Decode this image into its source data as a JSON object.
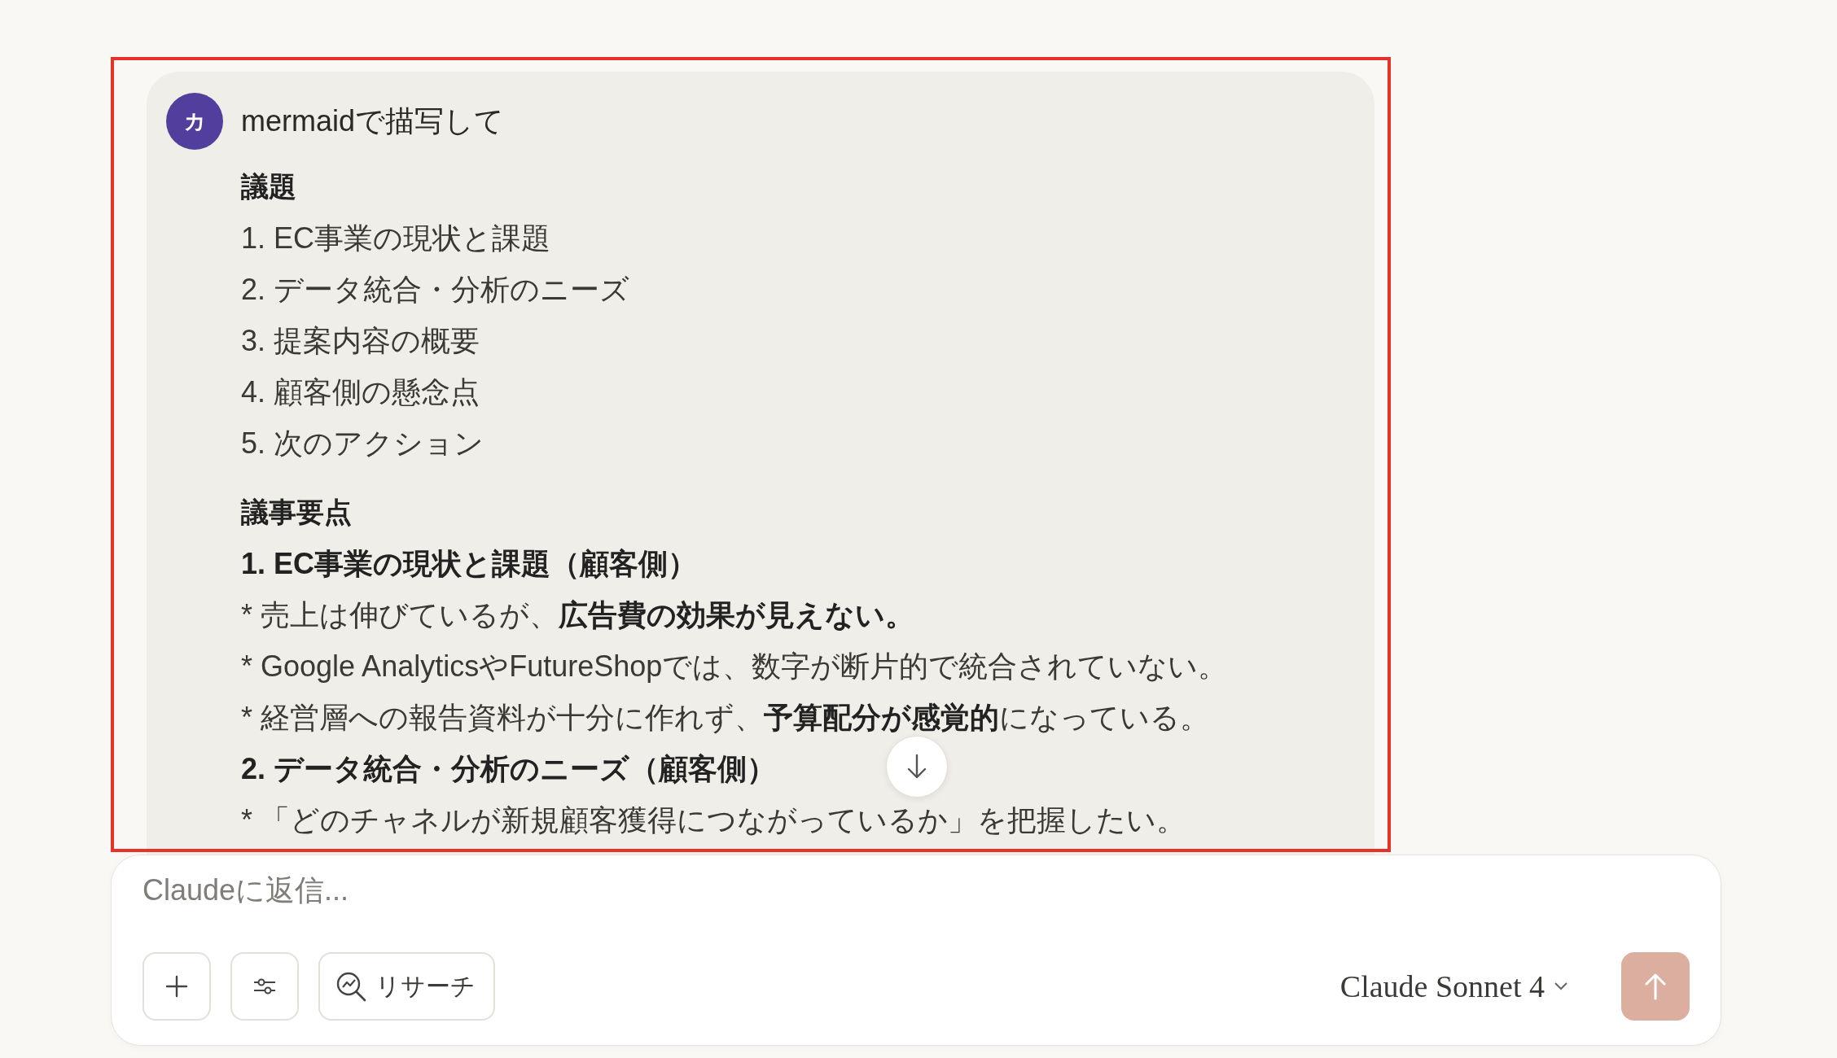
{
  "message": {
    "avatar": "カ",
    "text": "mermaidで描写して",
    "lines": [
      {
        "kind": "heading",
        "text": "議題"
      },
      {
        "kind": "item",
        "text": "1. EC事業の現状と課題"
      },
      {
        "kind": "item",
        "text": "2. データ統合・分析のニーズ"
      },
      {
        "kind": "item",
        "text": "3. 提案内容の概要"
      },
      {
        "kind": "item",
        "text": "4. 顧客側の懸念点"
      },
      {
        "kind": "item",
        "text": "5. 次のアクション"
      },
      {
        "kind": "heading",
        "text": "議事要点"
      },
      {
        "kind": "subheading",
        "text": "1. EC事業の現状と課題（顧客側）"
      },
      {
        "kind": "item",
        "text": "* 売上は伸びているが、**広告費の効果が見えない。**"
      },
      {
        "kind": "item",
        "text": "* Google AnalyticsやFutureShopでは、数字が断片的で統合されていない。"
      },
      {
        "kind": "item",
        "text": "* 経営層への報告資料が十分に作れず、**予算配分が感覚的**になっている。"
      },
      {
        "kind": "subheading",
        "text": "2. データ統合・分析のニーズ（顧客側）"
      },
      {
        "kind": "item",
        "text": "* 「どのチャネルが新規顧客獲得につながっているか」を把握したい。"
      }
    ]
  },
  "composer": {
    "placeholder": "Claudeに返信...",
    "research_label": "リサーチ",
    "model": "Claude Sonnet 4"
  }
}
